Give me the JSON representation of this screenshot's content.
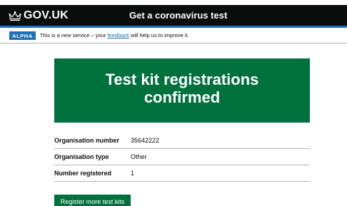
{
  "header": {
    "logo_text": "GOV.UK",
    "service_name": "Get a coronavirus test"
  },
  "phase_banner": {
    "tag": "ALPHA",
    "text_before": "This is a new service – your ",
    "link_text": "feedback",
    "text_after": " will help us to improve it."
  },
  "panel": {
    "title_line1": "Test kit registrations",
    "title_line2": "confirmed"
  },
  "summary": [
    {
      "key": "Organisation number",
      "value": "35642222"
    },
    {
      "key": "Organisation type",
      "value": "Other"
    },
    {
      "key": "Number registered",
      "value": "1"
    }
  ],
  "button_label": "Register more test kits",
  "colors": {
    "header_bg": "#0b0c0c",
    "accent_blue": "#1d70b8",
    "panel_green": "#00703c",
    "border_grey": "#b1b4b6"
  }
}
